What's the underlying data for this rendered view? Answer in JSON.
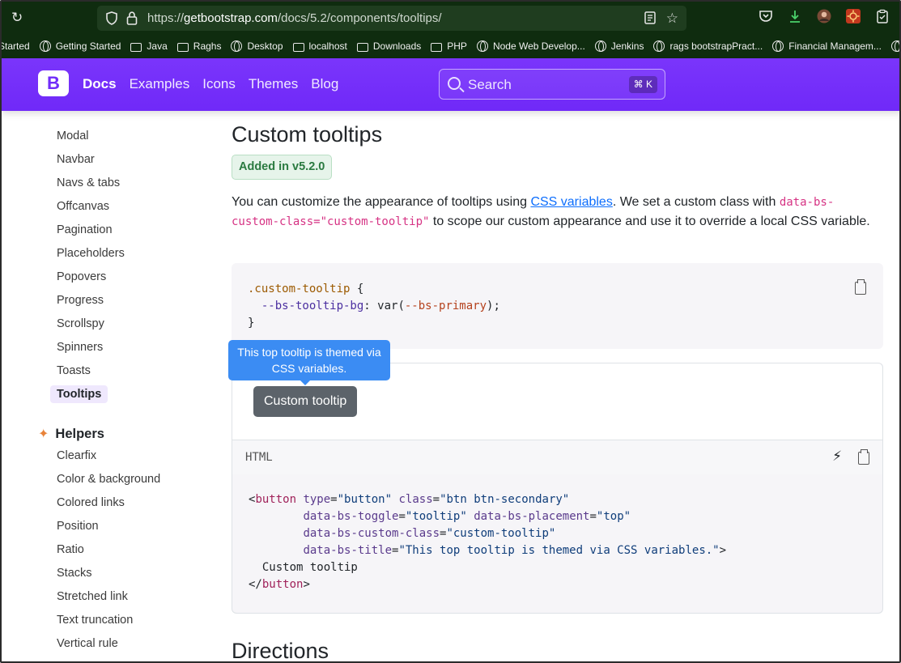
{
  "browser": {
    "url_prefix": "https://",
    "url_domain": "getbootstrap.com",
    "url_path": "/docs/5.2/components/tooltips/",
    "bookmarks": [
      {
        "label": "Started",
        "kind": "none"
      },
      {
        "label": "Getting Started",
        "kind": "globe"
      },
      {
        "label": "Java",
        "kind": "folder"
      },
      {
        "label": "Raghs",
        "kind": "folder"
      },
      {
        "label": "Desktop",
        "kind": "globe"
      },
      {
        "label": "localhost",
        "kind": "folder"
      },
      {
        "label": "Downloads",
        "kind": "folder"
      },
      {
        "label": "PHP",
        "kind": "folder"
      },
      {
        "label": "Node Web Develop...",
        "kind": "globe"
      },
      {
        "label": "Jenkins",
        "kind": "globe"
      },
      {
        "label": "rags bootstrapPract...",
        "kind": "globe"
      },
      {
        "label": "Financial Managem...",
        "kind": "globe"
      }
    ]
  },
  "navbar": {
    "logo": "B",
    "links": [
      "Docs",
      "Examples",
      "Icons",
      "Themes",
      "Blog"
    ],
    "search_placeholder": "Search",
    "search_shortcut": "⌘ K",
    "accent": "#712cf9"
  },
  "sidebar": {
    "items": [
      "Modal",
      "Navbar",
      "Navs & tabs",
      "Offcanvas",
      "Pagination",
      "Placeholders",
      "Popovers",
      "Progress",
      "Scrollspy",
      "Spinners",
      "Toasts"
    ],
    "active_item": "Tooltips",
    "section": "Helpers",
    "helper_items": [
      "Clearfix",
      "Color & background",
      "Colored links",
      "Position",
      "Ratio",
      "Stacks",
      "Stretched link",
      "Text truncation",
      "Vertical rule"
    ]
  },
  "main": {
    "title": "Custom tooltips",
    "badge": "Added in v5.2.0",
    "para_1": "You can customize the appearance of tooltips using ",
    "para_link": "CSS variables",
    "para_2": ". We set a custom class with ",
    "para_code": "data-bs-custom-class=\"custom-tooltip\"",
    "para_3": " to scope our custom appearance and use it to override a local CSS variable.",
    "css_code": {
      "selector": ".custom-tooltip",
      "open": " {",
      "prop": "--bs-tooltip-bg",
      "value_fn": "var(",
      "value_var": "--bs-primary",
      "value_end": ");",
      "close": "}"
    },
    "tooltip_text": "This top tooltip is themed via CSS variables.",
    "button_label": "Custom tooltip",
    "html_label": "HTML",
    "html_code": {
      "tag_open": "button",
      "attr_type": "type",
      "val_type": "\"button\"",
      "attr_class": "class",
      "val_class": "\"btn btn-secondary\"",
      "attr_toggle": "data-bs-toggle",
      "val_toggle": "\"tooltip\"",
      "attr_placement": "data-bs-placement",
      "val_placement": "\"top\"",
      "attr_custom": "data-bs-custom-class",
      "val_custom": "\"custom-tooltip\"",
      "attr_title": "data-bs-title",
      "val_title": "\"This top tooltip is themed via CSS variables.\"",
      "inner": "Custom tooltip",
      "tag_close": "button"
    },
    "next_heading": "Directions"
  }
}
